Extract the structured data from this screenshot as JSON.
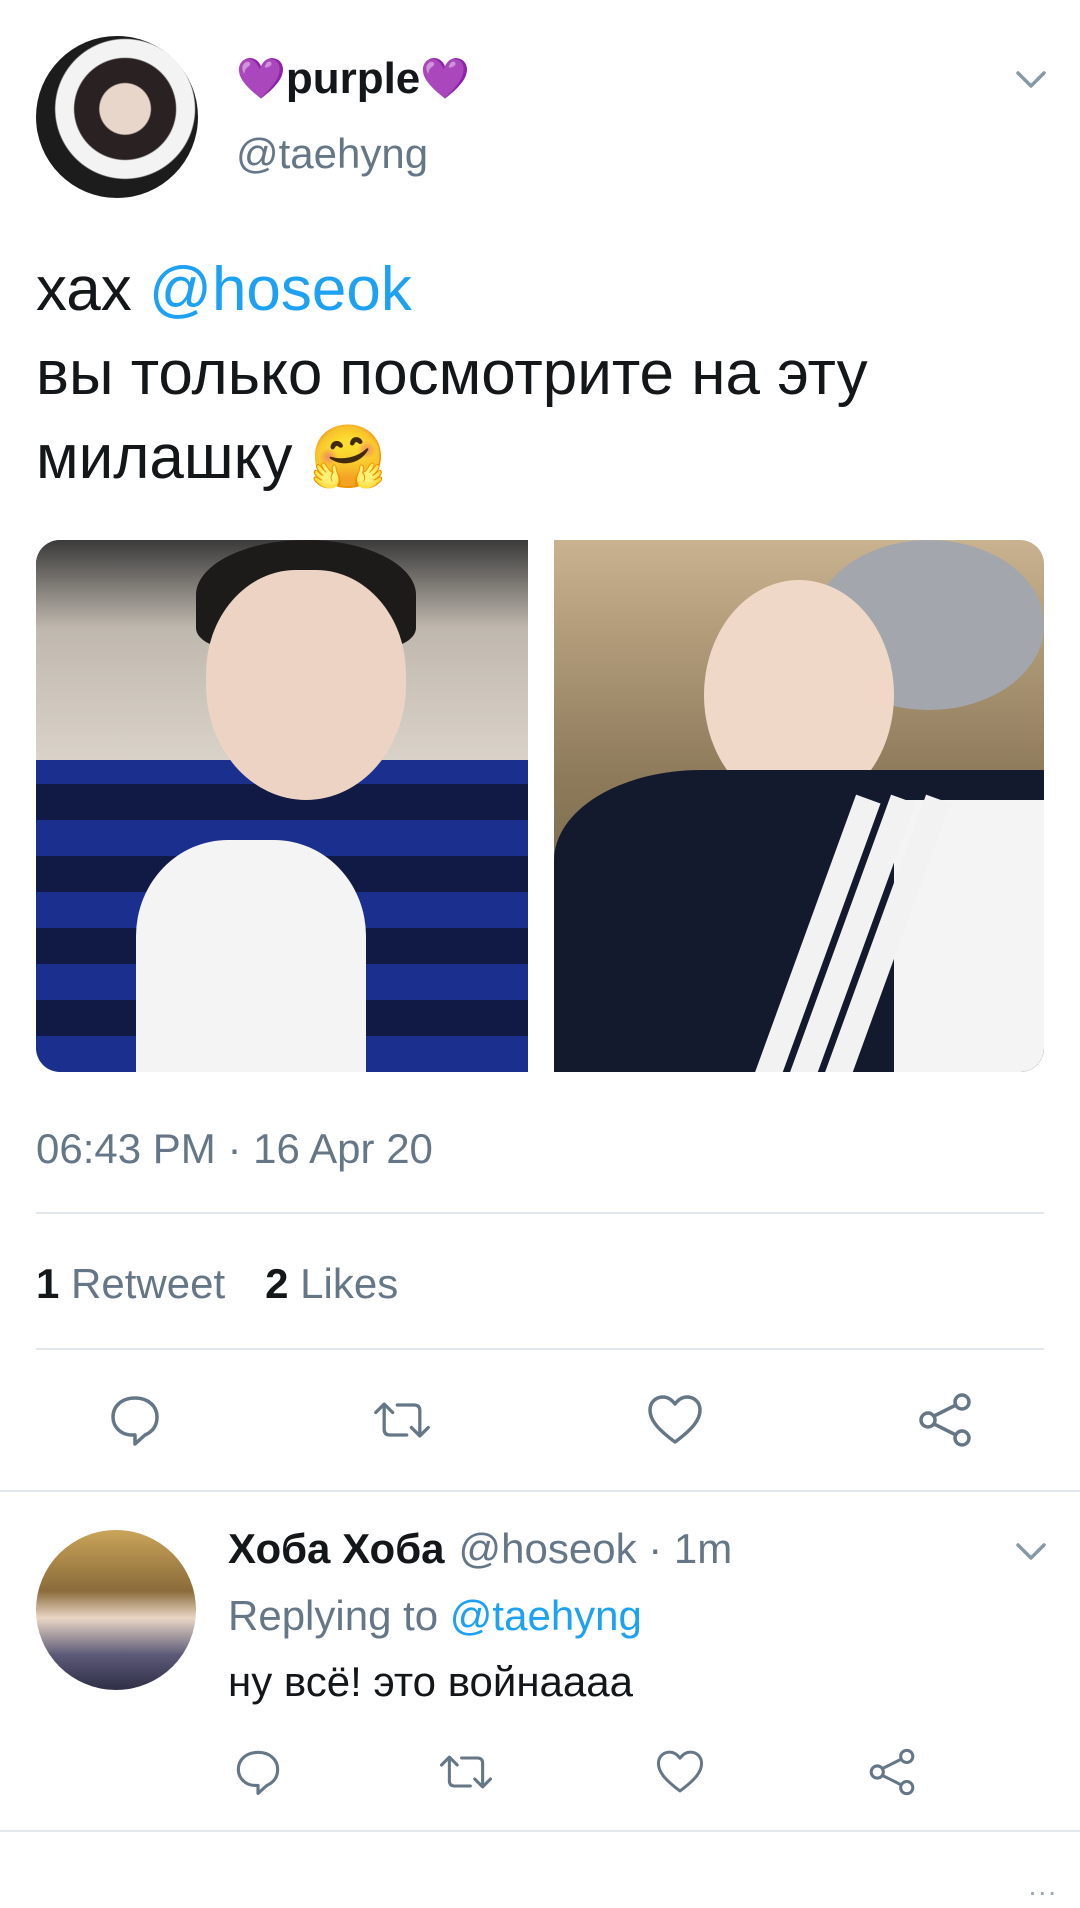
{
  "tweet": {
    "display_name": "purple",
    "heart_left": "💜",
    "heart_right": "💜",
    "handle": "@taehyng",
    "text_line1_prefix": "хах ",
    "text_mention": "@hoseok",
    "text_line2": "вы только посмотрите на эту",
    "text_line3": "милашку 🤗",
    "timestamp": "06:43 PM · 16 Apr 20",
    "retweet_count": "1",
    "retweet_label": "Retweet",
    "like_count": "2",
    "like_label": "Likes"
  },
  "reply": {
    "display_name": "Хоба Хоба",
    "handle_time": "@hoseok · 1m",
    "replying_prefix": "Replying to ",
    "replying_to": "@taehyng",
    "text": "ну всё! это войнаааа"
  },
  "footer": {
    "dots": "..."
  },
  "colors": {
    "accent": "#1da1f2",
    "secondary_text": "#657786",
    "divider": "#e1e8ed",
    "heart": "#7b3fe4"
  },
  "icons": [
    "chevron-down-icon",
    "reply-icon",
    "retweet-icon",
    "like-icon",
    "share-icon"
  ]
}
